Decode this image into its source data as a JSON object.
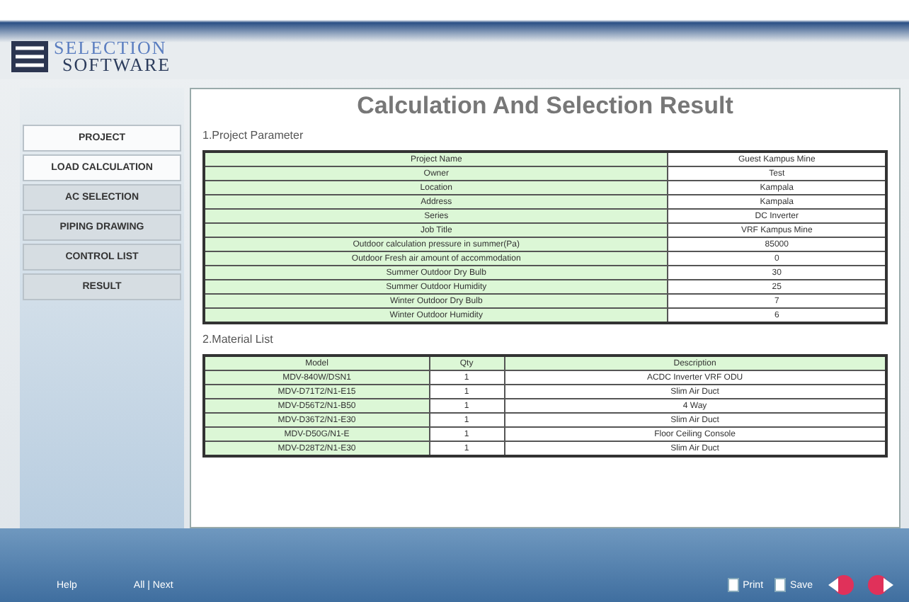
{
  "logo": {
    "line1": "SELECTION",
    "line2": "SOFTWARE"
  },
  "sidebar": {
    "items": [
      {
        "label": "PROJECT",
        "selected": true
      },
      {
        "label": "LOAD CALCULATION",
        "selected": true
      },
      {
        "label": "AC SELECTION",
        "selected": false
      },
      {
        "label": "PIPING DRAWING",
        "selected": false
      },
      {
        "label": "CONTROL LIST",
        "selected": false
      },
      {
        "label": "RESULT",
        "selected": false
      }
    ]
  },
  "title": "Calculation And Selection Result",
  "parameters": {
    "heading": "1.Project Parameter",
    "rows": [
      [
        "Project Name",
        "Guest Kampus Mine"
      ],
      [
        "Owner",
        "Test"
      ],
      [
        "Location",
        "Kampala"
      ],
      [
        "Address",
        "Kampala"
      ],
      [
        "Series",
        "DC Inverter"
      ],
      [
        "Job Title",
        "VRF Kampus Mine"
      ],
      [
        "Outdoor calculation pressure in summer(Pa)",
        "85000"
      ],
      [
        "Outdoor Fresh air amount of accommodation",
        "0"
      ],
      [
        "Summer Outdoor Dry Bulb",
        "30"
      ],
      [
        "Summer Outdoor Humidity",
        "25"
      ],
      [
        "Winter Outdoor Dry Bulb",
        "7"
      ],
      [
        "Winter Outdoor Humidity",
        "6"
      ]
    ]
  },
  "materials": {
    "heading": "2.Material List",
    "columns": [
      "Model",
      "Qty",
      "Description"
    ],
    "rows": [
      [
        "MDV-840W/DSN1",
        "1",
        "ACDC Inverter VRF ODU"
      ],
      [
        "MDV-D71T2/N1-E15",
        "1",
        "Slim Air Duct"
      ],
      [
        "MDV-D56T2/N1-B50",
        "1",
        "4 Way"
      ],
      [
        "MDV-D36T2/N1-E30",
        "1",
        "Slim Air Duct"
      ],
      [
        "MDV-D50G/N1-E",
        "1",
        "Floor Ceiling Console"
      ],
      [
        "MDV-D28T2/N1-E30",
        "1",
        "Slim Air Duct"
      ]
    ]
  },
  "footer": {
    "left": [
      "Help",
      "All | Next"
    ],
    "actions": [
      "Print",
      "Save"
    ]
  }
}
